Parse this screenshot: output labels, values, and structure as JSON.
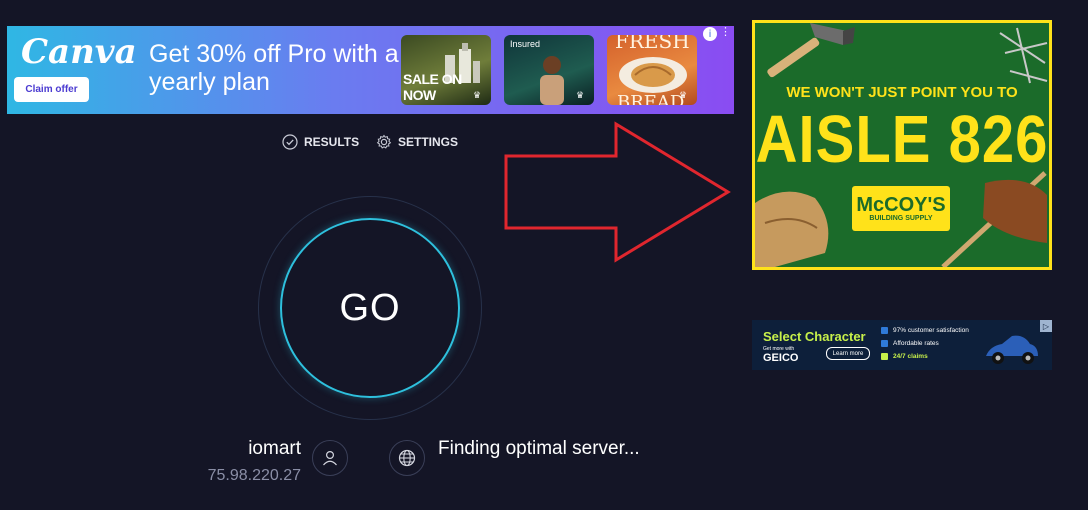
{
  "top_ad": {
    "logo": "Canva",
    "claim_button": "Claim offer",
    "headline": "Get 30% off Pro with a yearly plan",
    "tile1_text": "SALE ON NOW",
    "tile2_text": "Insured",
    "tile3_top": "FRESH",
    "tile3_bottom": "BREAD",
    "info_icon": "i",
    "close_icon": "⋮"
  },
  "nav": {
    "results_label": "RESULTS",
    "settings_label": "SETTINGS"
  },
  "speedtest": {
    "go_label": "GO",
    "isp_name": "iomart",
    "ip_address": "75.98.220.27",
    "server_status": "Finding optimal server..."
  },
  "annotation": {
    "arrow_color": "#e0262e"
  },
  "mccoys_ad": {
    "line1": "WE WON'T JUST POINT YOU TO",
    "line2": "AISLE 826",
    "brand": "McCOY'S",
    "sub": "BUILDING SUPPLY"
  },
  "geico_ad": {
    "headline": "Select Character",
    "small_text": "Get more with",
    "brand": "GEICO",
    "learn_more": "Learn more",
    "bullets": [
      "97% customer satisfaction",
      "Affordable rates",
      "24/7 claims"
    ]
  },
  "colors": {
    "background": "#141526",
    "accent_ring": "#2ec0dd",
    "mccoys_green": "#1b6b2a",
    "mccoys_yellow": "#ffe21a"
  }
}
